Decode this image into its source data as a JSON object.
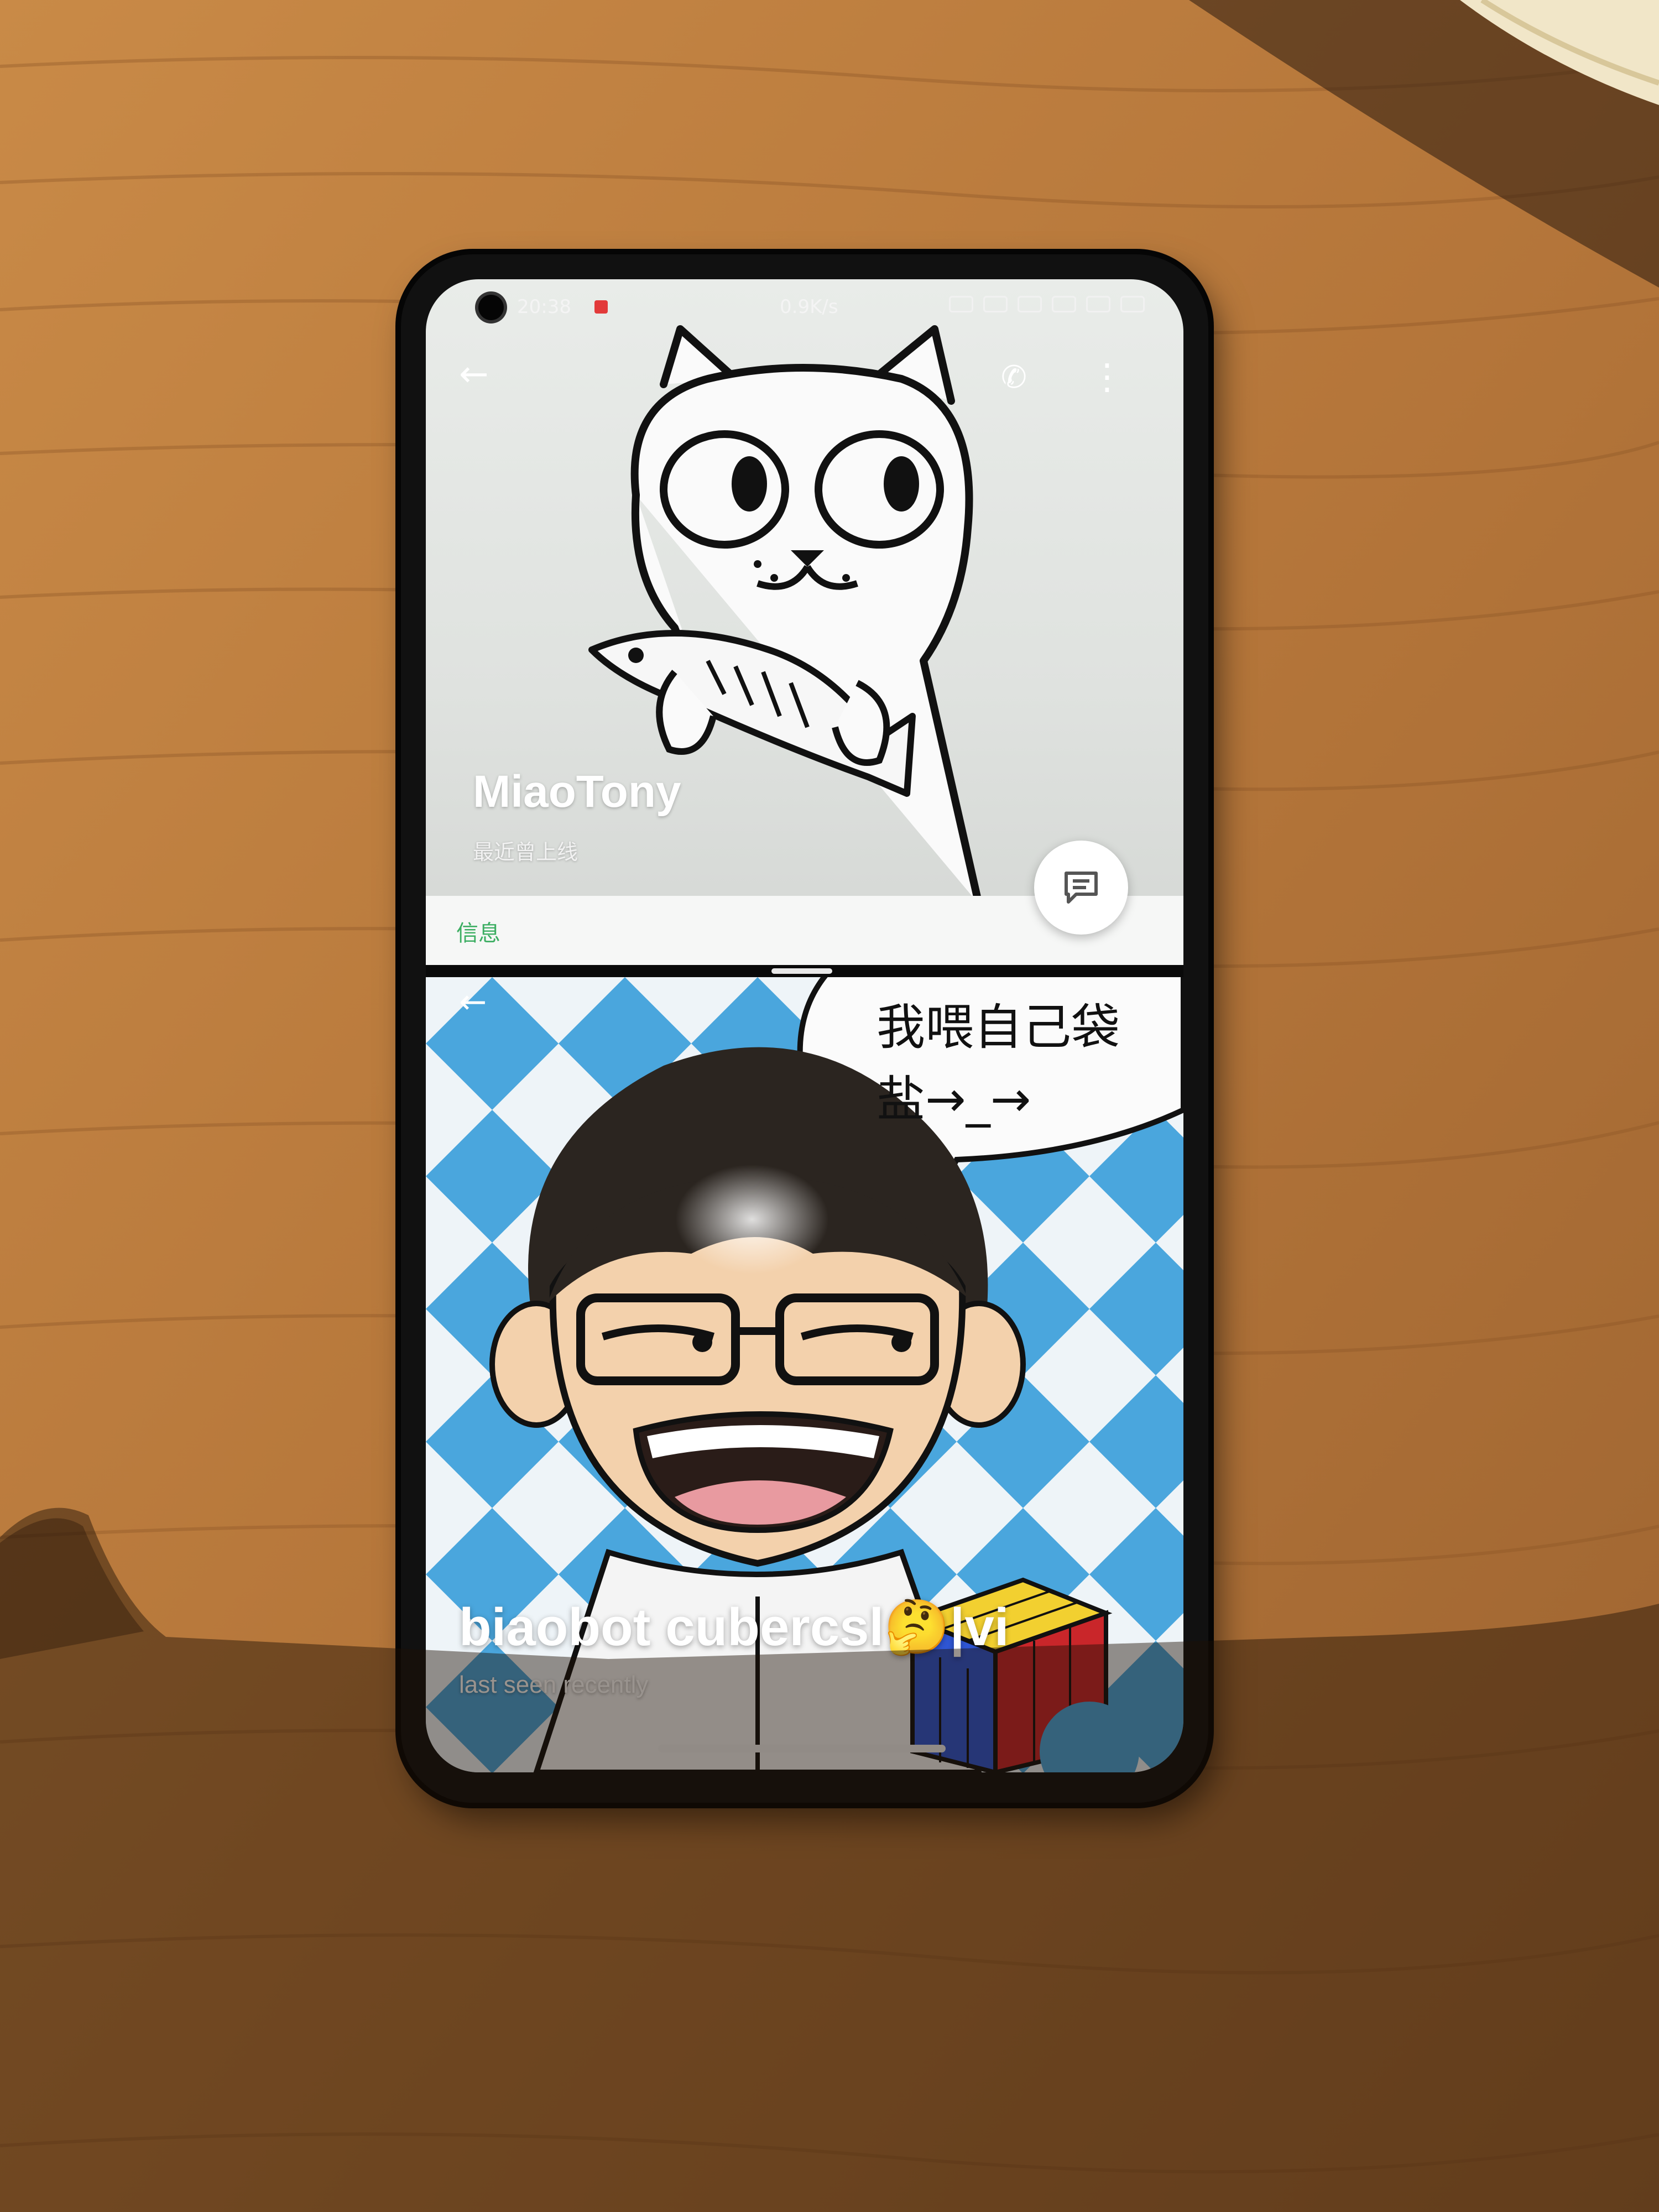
{
  "status_bar": {
    "time": "20:38",
    "network_speed": "0.9K/s"
  },
  "top_pane": {
    "back_icon": "arrow-left-icon",
    "call_icon": "phone-icon",
    "menu_icon": "more-vertical-icon",
    "profile_name": "MiaoTony",
    "profile_status": "最近曾上线",
    "info_tab": "信息",
    "fab_icon": "message-icon"
  },
  "bottom_pane": {
    "back_icon": "arrow-left-icon",
    "speech_line_1": "我喂自己袋",
    "speech_line_2": "盐→_→",
    "profile_name": "biaobot    cubercsl🤔|vi",
    "profile_status": "last seen recently"
  },
  "colors": {
    "wood": "#b97a3c",
    "accent_green": "#3cae62",
    "checker_blue": "#4aa6dd"
  }
}
